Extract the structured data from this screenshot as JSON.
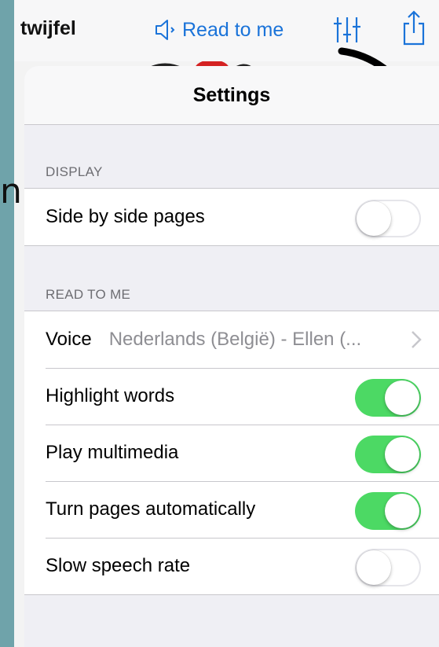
{
  "toolbar": {
    "book_title": "twijfel",
    "read_to_me_label": "Read to me",
    "icons": [
      "speaker-icon",
      "sliders-icon",
      "share-icon"
    ],
    "accent_color": "#1a73d9"
  },
  "background": {
    "partial_letter": "n"
  },
  "settings": {
    "title": "Settings",
    "sections": [
      {
        "header": "DISPLAY",
        "rows": [
          {
            "label": "Side by side pages",
            "toggle": false
          }
        ]
      },
      {
        "header": "READ TO ME",
        "rows": [
          {
            "label": "Voice",
            "value": "Nederlands (België) - Ellen (..."
          },
          {
            "label": "Highlight words",
            "toggle": true
          },
          {
            "label": "Play multimedia",
            "toggle": true
          },
          {
            "label": "Turn pages automatically",
            "toggle": true
          },
          {
            "label": "Slow speech rate",
            "toggle": false
          }
        ]
      }
    ],
    "toggle_on_color": "#4cd964"
  }
}
